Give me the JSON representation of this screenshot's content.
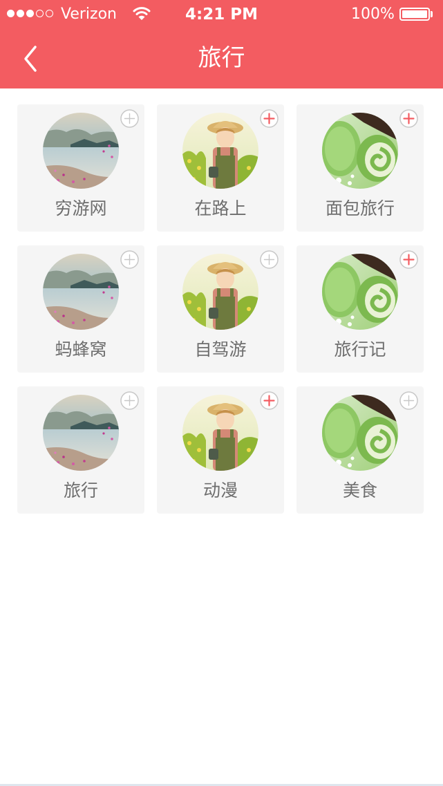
{
  "status_bar": {
    "carrier": "Verizon",
    "time": "4:21 PM",
    "battery": "100%",
    "signal_filled": 3,
    "signal_total": 5
  },
  "nav": {
    "title": "旅行",
    "back_icon": "chevron-left-icon"
  },
  "colors": {
    "accent": "#f35c61",
    "card_bg": "#f5f5f5",
    "label": "#6e6e6e",
    "add_active": "#f35c61",
    "add_inactive": "#c8c8c8"
  },
  "items": [
    {
      "label": "穷游网",
      "image": "lake-landscape",
      "added": false
    },
    {
      "label": "在路上",
      "image": "anime-farmer",
      "added": true
    },
    {
      "label": "面包旅行",
      "image": "green-tea-roll-cake",
      "added": true
    },
    {
      "label": "蚂蜂窝",
      "image": "lake-landscape",
      "added": false
    },
    {
      "label": "自驾游",
      "image": "anime-farmer",
      "added": false
    },
    {
      "label": "旅行记",
      "image": "green-tea-roll-cake",
      "added": true
    },
    {
      "label": "旅行",
      "image": "lake-landscape",
      "added": false
    },
    {
      "label": "动漫",
      "image": "anime-farmer",
      "added": true
    },
    {
      "label": "美食",
      "image": "green-tea-roll-cake",
      "added": false
    }
  ]
}
